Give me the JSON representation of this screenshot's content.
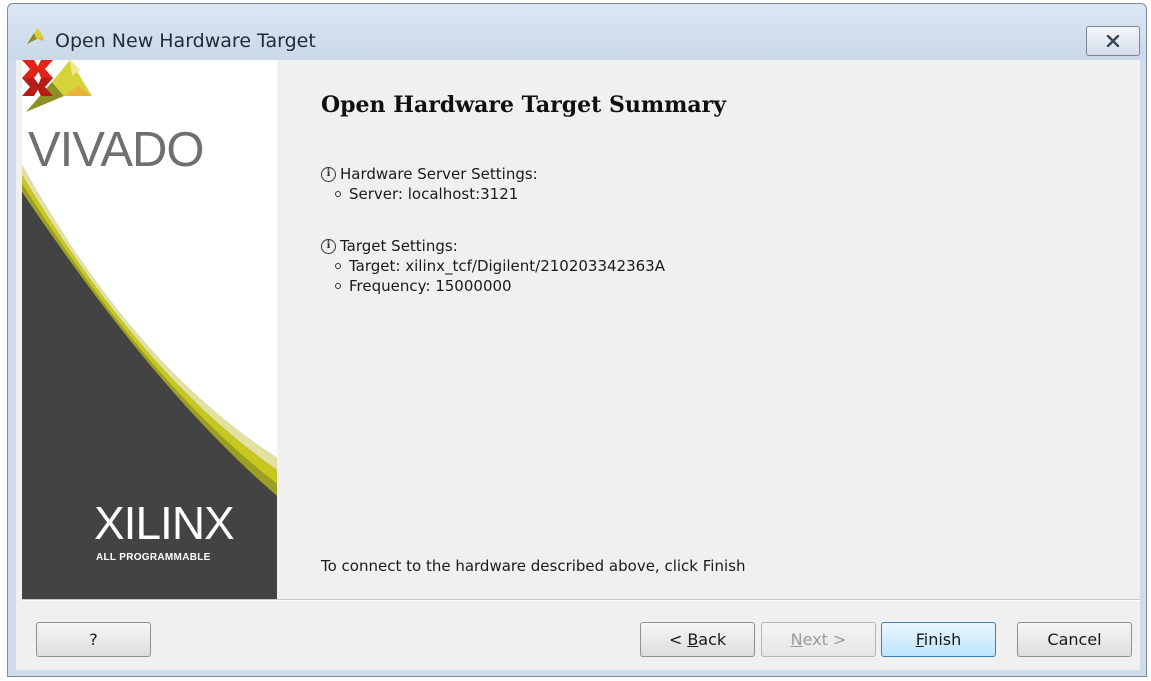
{
  "window": {
    "title": "Open New Hardware Target",
    "icon": "vivado-logo-icon",
    "close_icon": "close-x-icon"
  },
  "sidebar": {
    "vivado": "VIVADO",
    "xilinx": "XILINX",
    "tagline": "ALL PROGRAMMABLE",
    "colors": {
      "accent": "#c6c820",
      "dark": "#4a4a4a"
    }
  },
  "content": {
    "heading": "Open Hardware Target Summary",
    "sections": [
      {
        "label": "Hardware Server Settings:",
        "items": [
          "Server: localhost:3121"
        ]
      },
      {
        "label": "Target Settings:",
        "items": [
          "Target: xilinx_tcf/Digilent/210203342363A",
          "Frequency: 15000000"
        ]
      }
    ],
    "footer": "To connect to the hardware described above, click Finish"
  },
  "buttons": {
    "help": "?",
    "back_prefix": "< ",
    "back_mnemonic": "B",
    "back_rest": "ack",
    "next_mnemonic": "N",
    "next_rest": "ext >",
    "finish_mnemonic": "F",
    "finish_rest": "inish",
    "cancel": "Cancel"
  }
}
